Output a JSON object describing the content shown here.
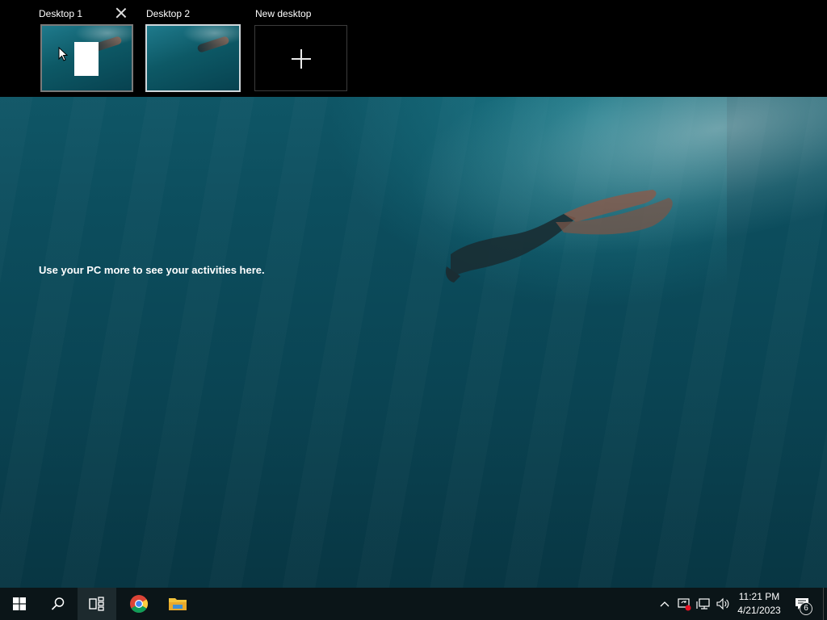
{
  "desktops": [
    {
      "label": "Desktop 1",
      "active": false
    },
    {
      "label": "Desktop 2",
      "active": true
    }
  ],
  "new_desktop_label": "New desktop",
  "activity_message": "Use your PC more to see your activities here.",
  "taskbar": {
    "items": [
      "start-icon",
      "search-icon",
      "task-view-icon",
      "chrome-icon",
      "file-explorer-icon"
    ],
    "clock_time": "11:21 PM",
    "clock_date": "4/21/2023",
    "notification_count": "6"
  },
  "colors": {
    "taskbar_bg": "#0b1518",
    "accent_blue": "#0078d7",
    "wallpaper_teal": "#0c4d5d"
  }
}
